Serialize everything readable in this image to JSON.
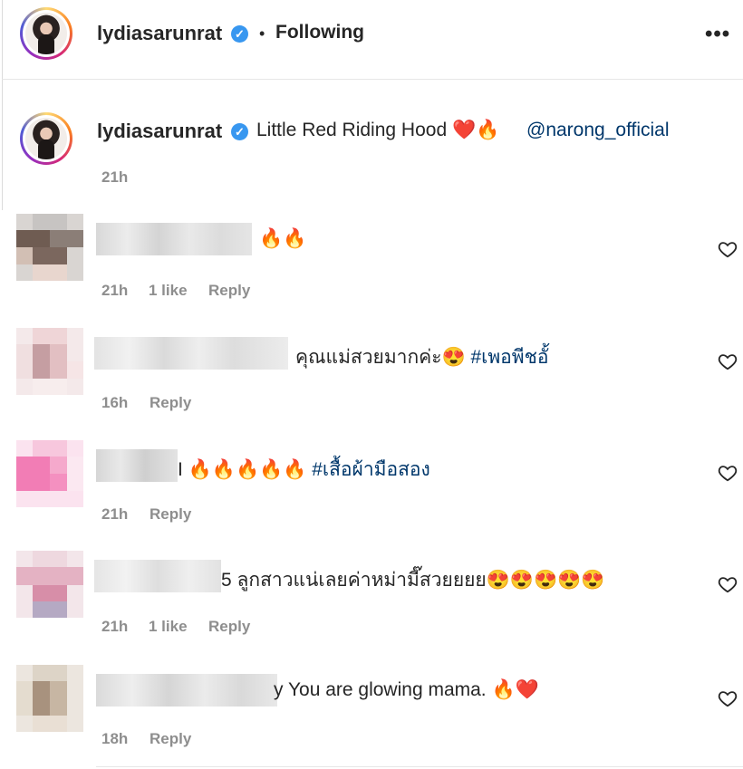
{
  "post": {
    "username": "lydiasarunrat",
    "separator": "•",
    "follow_status": "Following",
    "more_icon": "more-horizontal-icon"
  },
  "caption": {
    "username": "lydiasarunrat",
    "text": "Little Red Riding Hood ❤️🔥",
    "mention": "@narong_official",
    "time": "21h"
  },
  "comments": [
    {
      "text": "🔥🔥",
      "hashtag": "",
      "time": "21h",
      "likes": "1 like",
      "reply": "Reply"
    },
    {
      "text": "คุณแม่สวยมากค่ะ😍 ",
      "hashtag": "#เพอพีชอั้",
      "time": "16h",
      "likes": "",
      "reply": "Reply"
    },
    {
      "text": "I 🔥🔥🔥🔥🔥 ",
      "hashtag": "#เสื้อผ้ามือสอง",
      "time": "21h",
      "likes": "",
      "reply": "Reply"
    },
    {
      "text": "5 ลูกสาวแน่เลยค่าหม่ามี๊สวยยยย😍😍😍😍😍",
      "hashtag": "",
      "time": "21h",
      "likes": "1 like",
      "reply": "Reply"
    },
    {
      "text": "y You are glowing mama. 🔥❤️",
      "hashtag": "",
      "time": "18h",
      "likes": "",
      "reply": "Reply"
    }
  ],
  "colors": {
    "link": "#00376b",
    "meta": "#8e8e8e",
    "verified": "#3897f0"
  }
}
